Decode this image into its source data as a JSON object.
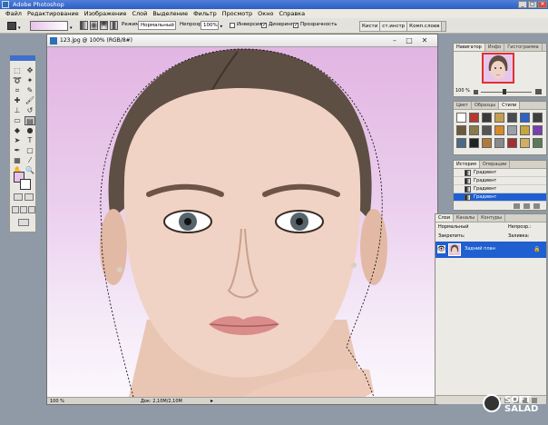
{
  "app": {
    "title": "Adobe Photoshop"
  },
  "menu": [
    "Файл",
    "Редактирование",
    "Изображение",
    "Слой",
    "Выделение",
    "Фильтр",
    "Просмотр",
    "Окно",
    "Справка"
  ],
  "options": {
    "mode_label": "Режим:",
    "mode_value": "Нормальный",
    "opacity_label": "Непрозр.:",
    "opacity_value": "100%",
    "inverse_label": "Инверсия",
    "dither_label": "Дизеринг",
    "transparency_label": "Прозрачность",
    "palette_well_tabs": [
      "Кисти",
      "ст.инстр",
      "Комп.слоев"
    ]
  },
  "colors": {
    "foreground": "#e7c3ea",
    "background": "#ffffff",
    "selection": "#1f5fd0"
  },
  "document": {
    "title": "123.jpg @ 100% (RGB/8#)",
    "zoom": "100 %",
    "doc_info": "Док: 2,10M/2,10M"
  },
  "navigator": {
    "tabs": [
      "Навигатор",
      "Инфо",
      "Гистограмма"
    ],
    "zoom": "100 %"
  },
  "styles_panel": {
    "tabs": [
      "Цвет",
      "Образцы",
      "Стили"
    ]
  },
  "history_panel": {
    "tabs": [
      "История",
      "Операции"
    ],
    "items": [
      "Градиент",
      "Градиент",
      "Градиент",
      "Градиент"
    ]
  },
  "layers_panel": {
    "tabs": [
      "Слои",
      "Каналы",
      "Контуры"
    ],
    "blend_mode": "Нормальный",
    "opacity_label": "Непрозр.:",
    "lock_label": "Закрепить:",
    "fill_label": "Заливка:",
    "layer_name": "Задний план"
  },
  "watermark": {
    "text": "SOFT SALAD"
  }
}
